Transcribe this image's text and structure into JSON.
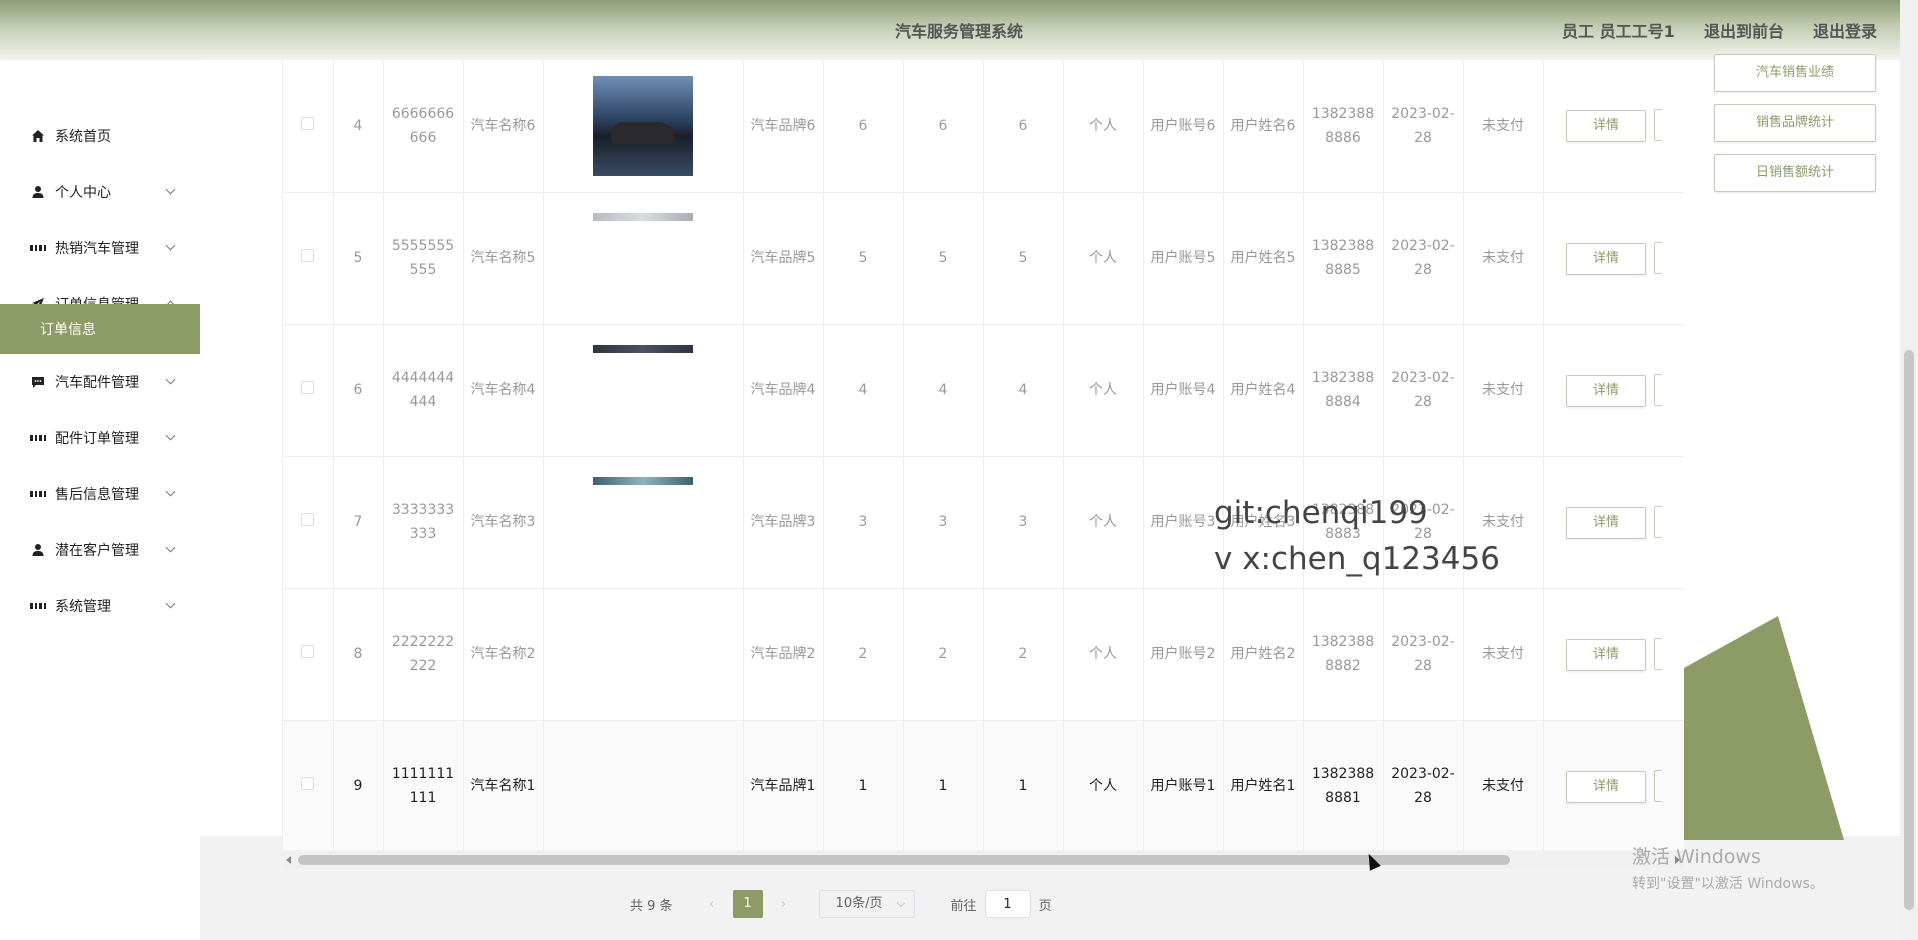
{
  "header": {
    "title": "汽车服务管理系统",
    "user_info": "员工 员工工号1",
    "to_front": "退出到前台",
    "logout": "退出登录"
  },
  "sidebar": {
    "items": [
      {
        "label": "系统首页",
        "icon": "home-icon"
      },
      {
        "label": "个人中心",
        "icon": "user-icon"
      },
      {
        "label": "热销汽车管理",
        "icon": "grid-icon"
      },
      {
        "label": "订单信息管理",
        "icon": "send-icon"
      },
      {
        "label": "订单信息",
        "icon": ""
      },
      {
        "label": "汽车配件管理",
        "icon": "message-icon"
      },
      {
        "label": "配件订单管理",
        "icon": "grid-icon"
      },
      {
        "label": "售后信息管理",
        "icon": "grid-icon"
      },
      {
        "label": "潜在客户管理",
        "icon": "user-icon"
      },
      {
        "label": "系统管理",
        "icon": "grid-icon"
      }
    ]
  },
  "table": {
    "rows": [
      {
        "index": "4",
        "order_no": "6666666666",
        "car_name": "汽车名称6",
        "brand": "汽车品牌6",
        "c1": "6",
        "c2": "6",
        "c3": "6",
        "type": "个人",
        "account": "用户账号6",
        "username": "用户姓名6",
        "phone": "13823888886",
        "date": "2023-02-28",
        "status": "未支付",
        "detail": "详情"
      },
      {
        "index": "5",
        "order_no": "5555555555",
        "car_name": "汽车名称5",
        "brand": "汽车品牌5",
        "c1": "5",
        "c2": "5",
        "c3": "5",
        "type": "个人",
        "account": "用户账号5",
        "username": "用户姓名5",
        "phone": "13823888885",
        "date": "2023-02-28",
        "status": "未支付",
        "detail": "详情"
      },
      {
        "index": "6",
        "order_no": "4444444444",
        "car_name": "汽车名称4",
        "brand": "汽车品牌4",
        "c1": "4",
        "c2": "4",
        "c3": "4",
        "type": "个人",
        "account": "用户账号4",
        "username": "用户姓名4",
        "phone": "13823888884",
        "date": "2023-02-28",
        "status": "未支付",
        "detail": "详情"
      },
      {
        "index": "7",
        "order_no": "3333333333",
        "car_name": "汽车名称3",
        "brand": "汽车品牌3",
        "c1": "3",
        "c2": "3",
        "c3": "3",
        "type": "个人",
        "account": "用户账号3",
        "username": "用户姓名3",
        "phone": "13823888883",
        "date": "2023-02-28",
        "status": "未支付",
        "detail": "详情"
      },
      {
        "index": "8",
        "order_no": "2222222222",
        "car_name": "汽车名称2",
        "brand": "汽车品牌2",
        "c1": "2",
        "c2": "2",
        "c3": "2",
        "type": "个人",
        "account": "用户账号2",
        "username": "用户姓名2",
        "phone": "13823888882",
        "date": "2023-02-28",
        "status": "未支付",
        "detail": "详情"
      },
      {
        "index": "9",
        "order_no": "1111111111",
        "car_name": "汽车名称1",
        "brand": "汽车品牌1",
        "c1": "1",
        "c2": "1",
        "c3": "1",
        "type": "个人",
        "account": "用户账号1",
        "username": "用户姓名1",
        "phone": "13823888881",
        "date": "2023-02-28",
        "status": "未支付",
        "detail": "详情"
      }
    ]
  },
  "pagination": {
    "total": "共 9 条",
    "current": "1",
    "page_size": "10条/页",
    "goto_label": "前往",
    "goto_value": "1",
    "page_suffix": "页"
  },
  "right_panel": {
    "buttons": [
      "汽车销售业绩",
      "销售品牌统计",
      "日销售额统计"
    ]
  },
  "overlay": {
    "watermark_line1": "git:chenqi199",
    "watermark_line2": "v x:chen_q123456",
    "activate_title": "激活 Windows",
    "activate_sub": "转到\"设置\"以激活 Windows。"
  },
  "colors": {
    "accent": "#8d9c66",
    "header_dark": "#8d9c75"
  }
}
